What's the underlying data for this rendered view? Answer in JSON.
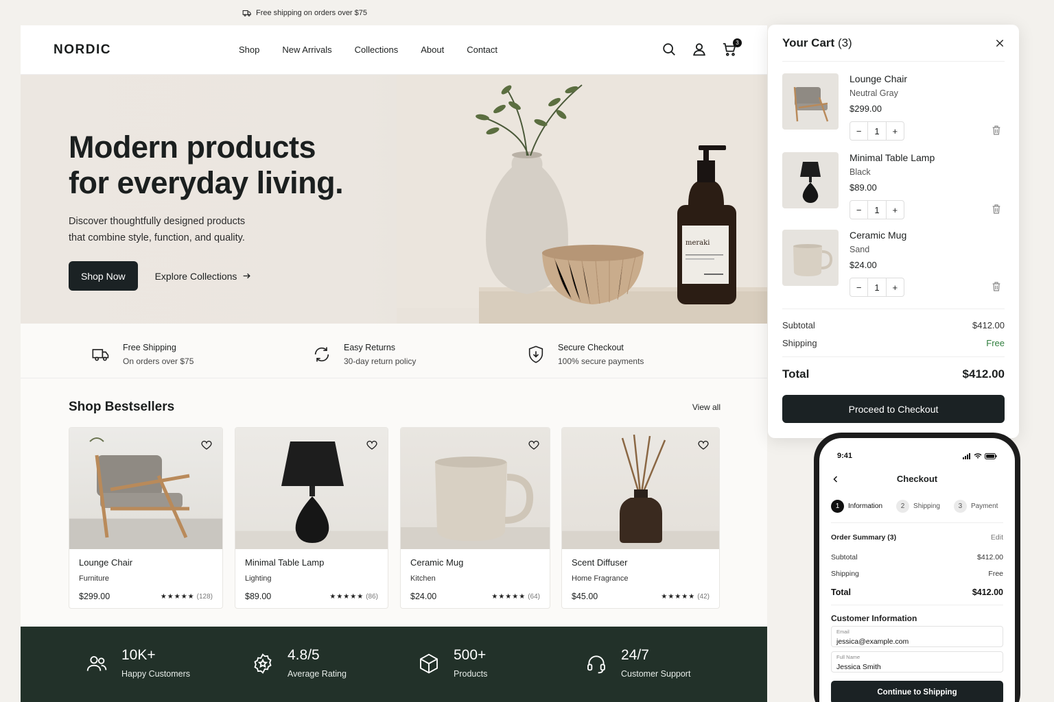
{
  "announcement": {
    "text": "Free shipping on orders over $75",
    "icon": "truck-icon"
  },
  "header": {
    "logo": "NORDIC",
    "nav": [
      "Shop",
      "New Arrivals",
      "Collections",
      "About",
      "Contact"
    ],
    "cart_count": "3"
  },
  "hero": {
    "title_line1": "Modern products",
    "title_line2": "for everyday living.",
    "subtitle_line1": "Discover thoughtfully designed products",
    "subtitle_line2": "that combine style, function, and quality.",
    "primary_cta": "Shop Now",
    "secondary_cta": "Explore Collections",
    "bottle_label": "meraki"
  },
  "features": [
    {
      "title": "Free Shipping",
      "sub": "On orders over $75",
      "icon": "truck-icon"
    },
    {
      "title": "Easy Returns",
      "sub": "30-day return policy",
      "icon": "refresh-icon"
    },
    {
      "title": "Secure Checkout",
      "sub": "100% secure payments",
      "icon": "shield-icon"
    }
  ],
  "bestsellers": {
    "title": "Shop Bestsellers",
    "view_all": "View all",
    "products": [
      {
        "name": "Lounge Chair",
        "category": "Furniture",
        "price": "$299.00",
        "stars": "★★★★★",
        "count": "(128)"
      },
      {
        "name": "Minimal Table Lamp",
        "category": "Lighting",
        "price": "$89.00",
        "stars": "★★★★★",
        "count": "(86)"
      },
      {
        "name": "Ceramic Mug",
        "category": "Kitchen",
        "price": "$24.00",
        "stars": "★★★★★",
        "count": "(64)"
      },
      {
        "name": "Scent Diffuser",
        "category": "Home Fragrance",
        "price": "$45.00",
        "stars": "★★★★★",
        "count": "(42)"
      }
    ]
  },
  "stats": [
    {
      "value": "10K+",
      "label": "Happy Customers",
      "icon": "users-icon"
    },
    {
      "value": "4.8/5",
      "label": "Average Rating",
      "icon": "star-badge-icon"
    },
    {
      "value": "500+",
      "label": "Products",
      "icon": "box-icon"
    },
    {
      "value": "24/7",
      "label": "Customer Support",
      "icon": "headset-icon"
    }
  ],
  "cart": {
    "title": "Your Cart",
    "count": "(3)",
    "items": [
      {
        "name": "Lounge Chair",
        "variant": "Neutral Gray",
        "price": "$299.00",
        "qty": "1"
      },
      {
        "name": "Minimal Table Lamp",
        "variant": "Black",
        "price": "$89.00",
        "qty": "1"
      },
      {
        "name": "Ceramic Mug",
        "variant": "Sand",
        "price": "$24.00",
        "qty": "1"
      }
    ],
    "subtotal_label": "Subtotal",
    "subtotal": "$412.00",
    "shipping_label": "Shipping",
    "shipping": "Free",
    "total_label": "Total",
    "total": "$412.00",
    "checkout": "Proceed to Checkout"
  },
  "mobile": {
    "time": "9:41",
    "title": "Checkout",
    "steps": [
      {
        "num": "1",
        "label": "Information"
      },
      {
        "num": "2",
        "label": "Shipping"
      },
      {
        "num": "3",
        "label": "Payment"
      }
    ],
    "summary_title": "Order Summary (3)",
    "edit": "Edit",
    "subtotal_label": "Subtotal",
    "subtotal": "$412.00",
    "shipping_label": "Shipping",
    "shipping": "Free",
    "total_label": "Total",
    "total": "$412.00",
    "customer_title": "Customer Information",
    "email_label": "Email",
    "email": "jessica@example.com",
    "name_label": "Full Name",
    "name": "Jessica Smith",
    "continue": "Continue to Shipping"
  },
  "colors": {
    "dark": "#1b2224",
    "footer_green": "#223129",
    "free_green": "#2e7d3c",
    "hero_bg": "#ece7e1"
  }
}
